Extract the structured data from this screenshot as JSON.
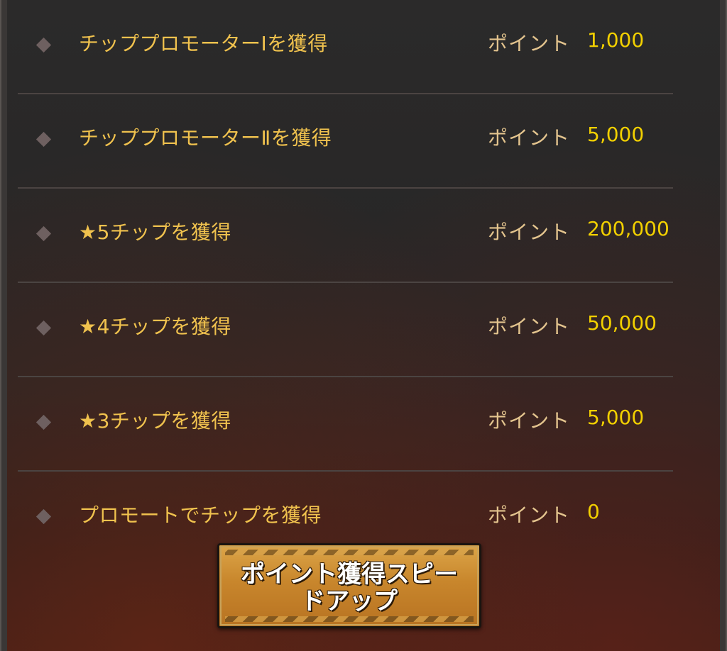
{
  "rewards": [
    {
      "label": "チッププロモーターⅠを獲得",
      "points_label": "ポイント",
      "points": "1,000"
    },
    {
      "label": "チッププロモーターⅡを獲得",
      "points_label": "ポイント",
      "points": "5,000"
    },
    {
      "label": "★5チップを獲得",
      "points_label": "ポイント",
      "points": "200,000"
    },
    {
      "label": "★4チップを獲得",
      "points_label": "ポイント",
      "points": "50,000"
    },
    {
      "label": "★3チップを獲得",
      "points_label": "ポイント",
      "points": "5,000"
    },
    {
      "label": "プロモートでチップを獲得",
      "points_label": "ポイント",
      "points": "0"
    }
  ],
  "speed_button": {
    "label": "ポイント獲得スピー\nドアップ"
  },
  "colors": {
    "label": "#f0c24e",
    "points_label": "#e3c48e",
    "points_value": "#f2d000",
    "divider": "#4b4442",
    "button": "#c8862c"
  }
}
